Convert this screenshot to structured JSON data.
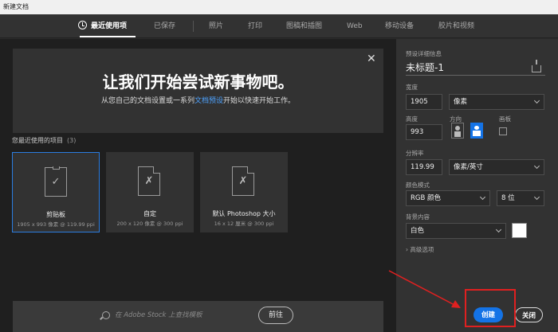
{
  "window": {
    "title": "新建文档"
  },
  "tabs": [
    {
      "label": "最近使用项"
    },
    {
      "label": "已保存"
    },
    {
      "label": "照片"
    },
    {
      "label": "打印"
    },
    {
      "label": "图稿和插图"
    },
    {
      "label": "Web"
    },
    {
      "label": "移动设备"
    },
    {
      "label": "胶片和视频"
    }
  ],
  "hero": {
    "title": "让我们开始尝试新事物吧。",
    "subtitle_before": "从您自己的文档设置或一系列",
    "subtitle_link": "文档预设",
    "subtitle_after": "开始以快速开始工作。"
  },
  "recent": {
    "title": "您最近使用的项目",
    "count": "(3)",
    "items": [
      {
        "name": "剪贴板",
        "dims": "1905 x 993 像素 @ 119.99 ppi"
      },
      {
        "name": "自定",
        "dims": "200 x 120 像素 @ 300 ppi"
      },
      {
        "name": "默认 Photoshop 大小",
        "dims": "16 x 12 厘米 @ 300 ppi"
      }
    ]
  },
  "search": {
    "placeholder": "在 Adobe Stock 上查找模板",
    "go_label": "前往"
  },
  "preset": {
    "section_label": "预设详细信息",
    "doc_title": "未标题-1",
    "width_label": "宽度",
    "width_value": "1905",
    "width_unit": "像素",
    "height_label": "高度",
    "height_value": "993",
    "orientation_label": "方向",
    "artboard_label": "画板",
    "resolution_label": "分辨率",
    "resolution_value": "119.99",
    "resolution_unit": "像素/英寸",
    "color_mode_label": "颜色模式",
    "color_mode_value": "RGB 颜色",
    "bit_depth": "8 位",
    "background_label": "背景内容",
    "background_value": "白色",
    "advanced_label": "高级选项"
  },
  "actions": {
    "create_label": "创建",
    "close_label": "关闭"
  },
  "colors": {
    "accent": "#1473e6",
    "annotation": "#e02020"
  }
}
